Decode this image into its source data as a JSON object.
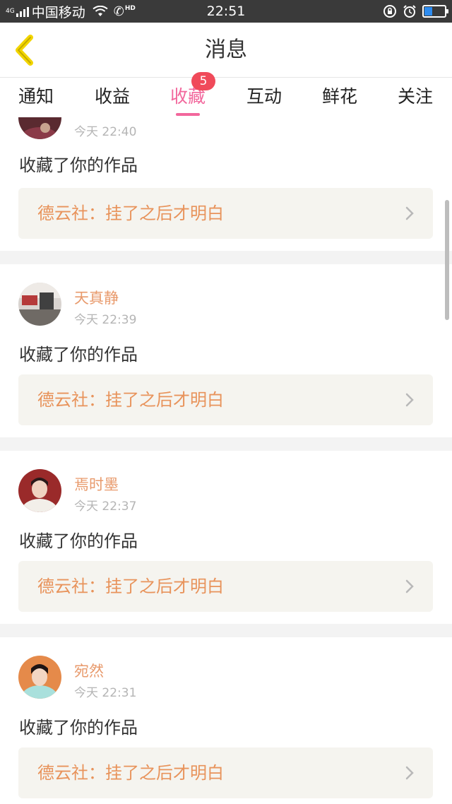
{
  "status_bar": {
    "network": "4G",
    "carrier": "中国移动",
    "call_badge": "HD",
    "time": "22:51",
    "battery_level": 0.4
  },
  "header": {
    "title": "消息"
  },
  "tabs": [
    {
      "label": "通知"
    },
    {
      "label": "收益"
    },
    {
      "label": "收藏",
      "active": true,
      "badge": "5"
    },
    {
      "label": "互动"
    },
    {
      "label": "鲜花"
    },
    {
      "label": "关注"
    }
  ],
  "feed": [
    {
      "nickname": "",
      "time": "今天 22:40",
      "action": "收藏了你的作品",
      "work_title": "德云社：挂了之后才明白"
    },
    {
      "nickname": "天真静",
      "time": "今天 22:39",
      "action": "收藏了你的作品",
      "work_title": "德云社：挂了之后才明白"
    },
    {
      "nickname": "焉时墨",
      "time": "今天 22:37",
      "action": "收藏了你的作品",
      "work_title": "德云社：挂了之后才明白"
    },
    {
      "nickname": "宛然",
      "time": "今天 22:31",
      "action": "收藏了你的作品",
      "work_title": "德云社：挂了之后才明白"
    }
  ],
  "colors": {
    "accent": "#f2679c",
    "badge": "#f04a5a",
    "nickname": "#e89a6c",
    "work_title": "#e8935b",
    "back_icon": "#f2d500"
  }
}
